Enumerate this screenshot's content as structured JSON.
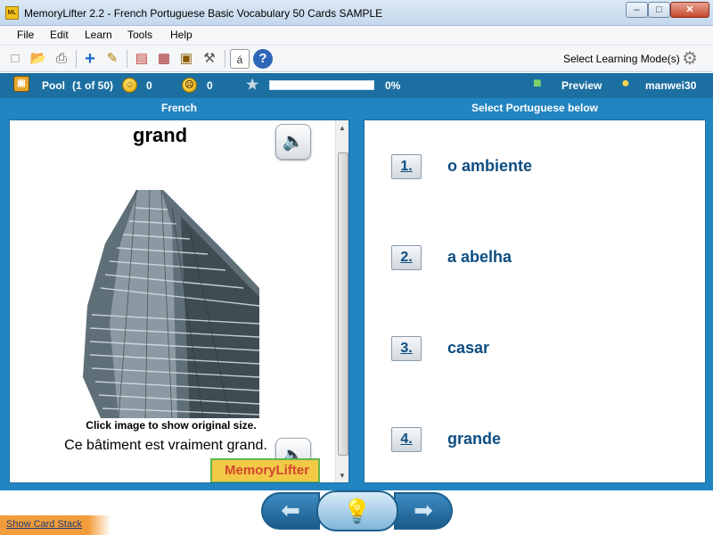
{
  "window": {
    "title": "MemoryLifter 2.2 - French Portuguese Basic Vocabulary 50 Cards SAMPLE",
    "app_icon": "ML"
  },
  "menu": [
    "File",
    "Edit",
    "Learn",
    "Tools",
    "Help"
  ],
  "toolbar": {
    "mode_label": "Select Learning Mode(s)"
  },
  "status": {
    "pool_label": "Pool",
    "pool_count": "(1 of 50)",
    "correct": "0",
    "wrong": "0",
    "progress_text": "0%",
    "progress_fraction": 0,
    "preview_label": "Preview",
    "user": "manwei30"
  },
  "question": {
    "header": "French",
    "word": "grand",
    "image_caption": "Click image to show original size.",
    "sentence": "Ce bâtiment est vraiment grand.",
    "logo_text": "MemoryLifter"
  },
  "answers": {
    "header": "Select Portuguese below",
    "options": [
      {
        "num": "1.",
        "text": "o ambiente"
      },
      {
        "num": "2.",
        "text": "a abelha"
      },
      {
        "num": "3.",
        "text": "casar"
      },
      {
        "num": "4.",
        "text": "grande"
      }
    ]
  },
  "bottom": {
    "show_card_stack": "Show Card Stack"
  },
  "colors": {
    "accent_blue": "#2284c0",
    "status_blue": "#1c6fa1",
    "answer_text": "#0d4d82"
  }
}
